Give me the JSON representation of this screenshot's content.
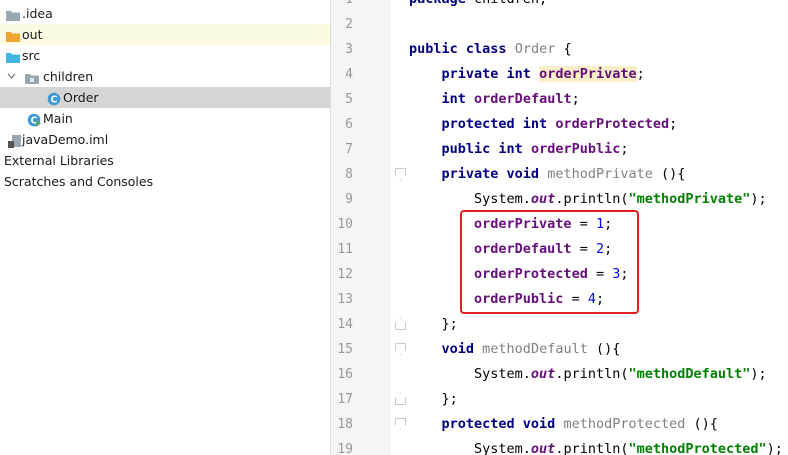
{
  "tree": {
    "items": [
      {
        "label": ".idea",
        "icon": "folder-icon"
      },
      {
        "label": "out",
        "icon": "folder-orange-icon"
      },
      {
        "label": "src",
        "icon": "folder-blue-icon"
      },
      {
        "label": "children",
        "icon": "package-icon"
      },
      {
        "label": "Order",
        "icon": "class-icon"
      },
      {
        "label": "Main",
        "icon": "class-runnable-icon"
      },
      {
        "label": "javaDemo.iml",
        "icon": "module-file-icon"
      },
      {
        "label": "External Libraries",
        "icon": ""
      },
      {
        "label": "Scratches and Consoles",
        "icon": ""
      }
    ],
    "class_icon_letter": "C"
  },
  "editor": {
    "lines": [
      {
        "n": "1",
        "t": [
          [
            "kw",
            "package"
          ],
          [
            "plain",
            " children;"
          ]
        ]
      },
      {
        "n": "2",
        "t": []
      },
      {
        "n": "3",
        "t": [
          [
            "kw",
            "public class"
          ],
          [
            "plain",
            " "
          ],
          [
            "gray",
            "Order"
          ],
          [
            "plain",
            " {"
          ]
        ]
      },
      {
        "n": "4",
        "t": [
          [
            "plain",
            "    "
          ],
          [
            "kw",
            "private int"
          ],
          [
            "plain",
            " "
          ],
          [
            "fldu",
            "orderPrivate"
          ],
          [
            "plain",
            ";"
          ]
        ]
      },
      {
        "n": "5",
        "t": [
          [
            "plain",
            "    "
          ],
          [
            "kw",
            "int"
          ],
          [
            "plain",
            " "
          ],
          [
            "fld",
            "orderDefault"
          ],
          [
            "plain",
            ";"
          ]
        ]
      },
      {
        "n": "6",
        "t": [
          [
            "plain",
            "    "
          ],
          [
            "kw",
            "protected int"
          ],
          [
            "plain",
            " "
          ],
          [
            "fld",
            "orderProtected"
          ],
          [
            "plain",
            ";"
          ]
        ]
      },
      {
        "n": "7",
        "t": [
          [
            "plain",
            "    "
          ],
          [
            "kw",
            "public int"
          ],
          [
            "plain",
            " "
          ],
          [
            "fld",
            "orderPublic"
          ],
          [
            "plain",
            ";"
          ]
        ]
      },
      {
        "n": "8",
        "t": [
          [
            "plain",
            "    "
          ],
          [
            "kw",
            "private void"
          ],
          [
            "plain",
            " "
          ],
          [
            "gray",
            "methodPrivate"
          ],
          [
            "plain",
            " (){"
          ]
        ]
      },
      {
        "n": "9",
        "t": [
          [
            "plain",
            "        System."
          ],
          [
            "static",
            "out"
          ],
          [
            "plain",
            ".println("
          ],
          [
            "str",
            "\"methodPrivate\""
          ],
          [
            "plain",
            ");"
          ]
        ]
      },
      {
        "n": "10",
        "t": [
          [
            "plain",
            "        "
          ],
          [
            "fld",
            "orderPrivate"
          ],
          [
            "plain",
            " = "
          ],
          [
            "num",
            "1"
          ],
          [
            "plain",
            ";"
          ]
        ]
      },
      {
        "n": "11",
        "t": [
          [
            "plain",
            "        "
          ],
          [
            "fld",
            "orderDefault"
          ],
          [
            "plain",
            " = "
          ],
          [
            "num",
            "2"
          ],
          [
            "plain",
            ";"
          ]
        ]
      },
      {
        "n": "12",
        "t": [
          [
            "plain",
            "        "
          ],
          [
            "fld",
            "orderProtected"
          ],
          [
            "plain",
            " = "
          ],
          [
            "num",
            "3"
          ],
          [
            "plain",
            ";"
          ]
        ]
      },
      {
        "n": "13",
        "t": [
          [
            "plain",
            "        "
          ],
          [
            "fld",
            "orderPublic"
          ],
          [
            "plain",
            " = "
          ],
          [
            "num",
            "4"
          ],
          [
            "plain",
            ";"
          ]
        ]
      },
      {
        "n": "14",
        "t": [
          [
            "plain",
            "    };"
          ]
        ]
      },
      {
        "n": "15",
        "t": [
          [
            "plain",
            "    "
          ],
          [
            "kw",
            "void"
          ],
          [
            "plain",
            " "
          ],
          [
            "gray",
            "methodDefault"
          ],
          [
            "plain",
            " (){"
          ]
        ]
      },
      {
        "n": "16",
        "t": [
          [
            "plain",
            "        System."
          ],
          [
            "static",
            "out"
          ],
          [
            "plain",
            ".println("
          ],
          [
            "str",
            "\"methodDefault\""
          ],
          [
            "plain",
            ");"
          ]
        ]
      },
      {
        "n": "17",
        "t": [
          [
            "plain",
            "    };"
          ]
        ]
      },
      {
        "n": "18",
        "t": [
          [
            "plain",
            "    "
          ],
          [
            "kw",
            "protected void"
          ],
          [
            "plain",
            " "
          ],
          [
            "gray",
            "methodProtected"
          ],
          [
            "plain",
            " (){"
          ]
        ]
      },
      {
        "n": "19",
        "t": [
          [
            "plain",
            "        System."
          ],
          [
            "static",
            "out"
          ],
          [
            "plain",
            ".println("
          ],
          [
            "str",
            "\"methodProtected\""
          ],
          [
            "plain",
            ");"
          ]
        ]
      }
    ],
    "fold_markers": {
      "8": "open",
      "14": "close",
      "15": "open",
      "17": "close",
      "18": "open"
    },
    "highlight_color": "#e02020"
  }
}
